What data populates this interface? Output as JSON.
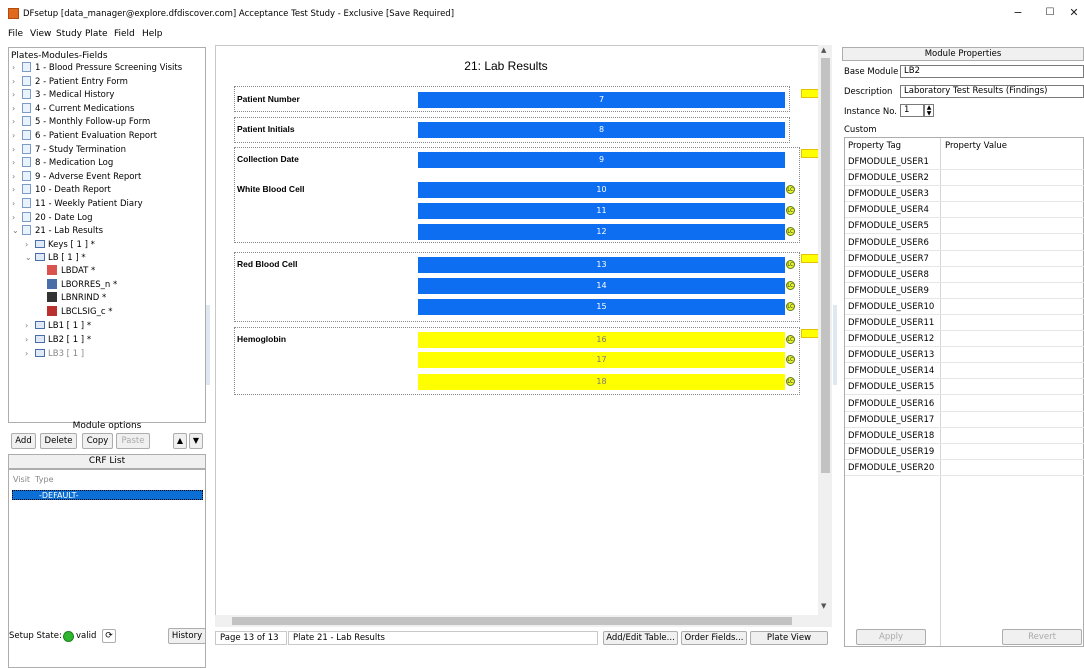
{
  "window": {
    "title": "DFsetup [data_manager@explore.dfdiscover.com] Acceptance Test Study - Exclusive [Save Required]",
    "min_glyph": "−",
    "max_glyph": "☐",
    "close_glyph": "✕"
  },
  "menu": [
    "File",
    "View",
    "Study",
    "Plate",
    "Field",
    "Help"
  ],
  "tree": {
    "header": "Plates-Modules-Fields",
    "plates": [
      "1 - Blood Pressure Screening Visits",
      "2 - Patient Entry Form",
      "3 - Medical History",
      "4 - Current Medications",
      "5 - Monthly Follow-up Form",
      "6 - Patient Evaluation Report",
      "7 - Study Termination",
      "8 - Medication Log",
      "9 - Adverse Event Report",
      "10 - Death Report",
      "11 - Weekly Patient Diary",
      "20 - Date Log",
      "21 - Lab Results"
    ],
    "modules": [
      "Keys [ 1 ] *",
      "LB [ 1 ] *"
    ],
    "fields": [
      "LBDAT *",
      "LBORRES_n *",
      "LBNRIND *",
      "LBCLSIG_c *"
    ],
    "more_modules": [
      "LB1 [ 1 ] *",
      "LB2 [ 1 ] *",
      "LB3 [ 1 ]"
    ]
  },
  "module_options": {
    "label": "Module options",
    "add": "Add",
    "delete": "Delete",
    "copy": "Copy",
    "paste": "Paste"
  },
  "crf": {
    "header": "CRF List",
    "col_visit": "Visit",
    "col_type": "Type",
    "selected": "-DEFAULT-"
  },
  "setup_state": {
    "label": "Setup State:",
    "value": "valid",
    "history": "History"
  },
  "plate": {
    "title": "21: Lab Results",
    "labels": {
      "patient_number": "Patient Number",
      "patient_initials": "Patient Initials",
      "collection_date": "Collection Date",
      "white_blood_cell": "White Blood Cell",
      "red_blood_cell": "Red Blood Cell",
      "hemoglobin": "Hemoglobin"
    },
    "fields": [
      "7",
      "8",
      "9",
      "10",
      "11",
      "12",
      "13",
      "14",
      "15",
      "16",
      "17",
      "18"
    ],
    "lc_text": "LC",
    "colors": {
      "blue": "#0d6ef2",
      "yellow": "#ffff00"
    }
  },
  "status_bar": {
    "page_label": "Page",
    "page_value": "13",
    "page_of": "of 13",
    "plate": "Plate 21 - Lab Results",
    "add_edit": "Add/Edit Table...",
    "order": "Order Fields...",
    "plate_view": "Plate View"
  },
  "module_properties": {
    "header": "Module Properties",
    "base_module_label": "Base Module",
    "base_module_value": "LB2",
    "description_label": "Description",
    "description_value": "Laboratory Test Results (Findings)",
    "instance_label": "Instance No.",
    "instance_value": "1",
    "custom_label": "Custom",
    "col_tag": "Property Tag",
    "col_value": "Property Value",
    "rows": [
      "DFMODULE_USER1",
      "DFMODULE_USER2",
      "DFMODULE_USER3",
      "DFMODULE_USER4",
      "DFMODULE_USER5",
      "DFMODULE_USER6",
      "DFMODULE_USER7",
      "DFMODULE_USER8",
      "DFMODULE_USER9",
      "DFMODULE_USER10",
      "DFMODULE_USER11",
      "DFMODULE_USER12",
      "DFMODULE_USER13",
      "DFMODULE_USER14",
      "DFMODULE_USER15",
      "DFMODULE_USER16",
      "DFMODULE_USER17",
      "DFMODULE_USER18",
      "DFMODULE_USER19",
      "DFMODULE_USER20"
    ],
    "apply": "Apply",
    "revert": "Revert"
  }
}
